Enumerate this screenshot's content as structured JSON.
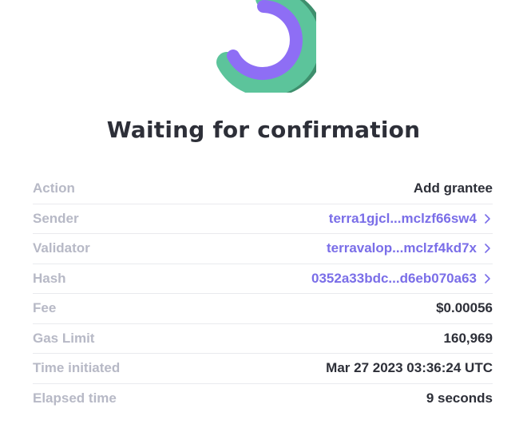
{
  "status": {
    "title": "Waiting for confirmation",
    "spinner_colors": {
      "outer": "#5cc49b",
      "shadow": "#3e8f6d",
      "inner": "#8e6ef5"
    }
  },
  "details": {
    "rows": [
      {
        "label": "Action",
        "value": "Add grantee",
        "link": false
      },
      {
        "label": "Sender",
        "value": "terra1gjcl...mclzf66sw4",
        "link": true,
        "icon": "chevron-right-icon"
      },
      {
        "label": "Validator",
        "value": "terravalop...mclzf4kd7x",
        "link": true,
        "icon": "chevron-right-icon"
      },
      {
        "label": "Hash",
        "value": "0352a33bdc...d6eb070a63",
        "link": true,
        "icon": "chevron-right-icon"
      },
      {
        "label": "Fee",
        "value": "$0.00056",
        "link": false
      },
      {
        "label": "Gas Limit",
        "value": "160,969",
        "link": false
      },
      {
        "label": "Time initiated",
        "value": "Mar 27 2023 03:36:24 UTC",
        "link": false
      },
      {
        "label": "Elapsed time",
        "value": "9 seconds",
        "link": false
      }
    ]
  }
}
